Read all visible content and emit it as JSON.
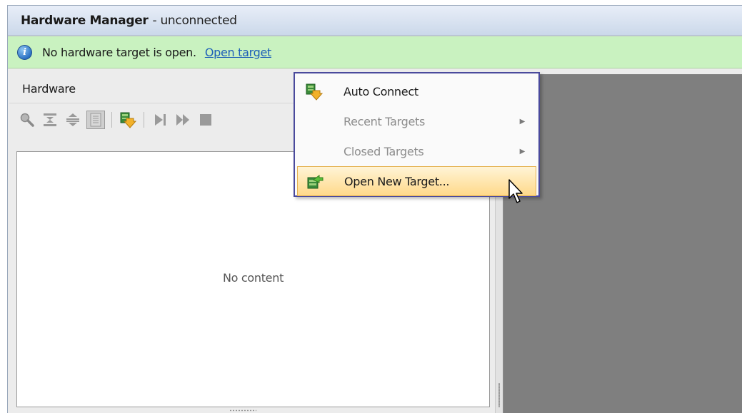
{
  "window": {
    "title": "Hardware Manager",
    "status": "- unconnected"
  },
  "banner": {
    "message": "No hardware target is open.",
    "link": "Open target",
    "icon": "info-icon"
  },
  "hardware_panel": {
    "title": "Hardware",
    "empty_message": "No content",
    "toolbar": [
      {
        "name": "search-icon",
        "enabled": false
      },
      {
        "name": "collapse-all-icon",
        "enabled": false
      },
      {
        "name": "expand-all-icon",
        "enabled": false
      },
      {
        "name": "properties-icon",
        "enabled": false
      },
      {
        "name": "auto-connect-icon",
        "enabled": true
      },
      {
        "name": "run-trigger-icon",
        "enabled": false
      },
      {
        "name": "run-trigger-immediate-icon",
        "enabled": false
      },
      {
        "name": "stop-trigger-icon",
        "enabled": false
      }
    ]
  },
  "context_menu": {
    "items": [
      {
        "label": "Auto Connect",
        "icon": "auto-connect-icon",
        "enabled": true,
        "submenu": false
      },
      {
        "label": "Recent Targets",
        "enabled": false,
        "submenu": true
      },
      {
        "label": "Closed Targets",
        "enabled": false,
        "submenu": true
      },
      {
        "label": "Open New Target...",
        "icon": "open-target-icon",
        "enabled": true,
        "submenu": false,
        "highlighted": true
      }
    ]
  },
  "colors": {
    "banner_bg": "#c9f2c0",
    "menu_border": "#4a4a9c",
    "menu_highlight": "#ffd98a",
    "right_panel_bg": "#7f7f7f",
    "link": "#1d5fb8"
  }
}
